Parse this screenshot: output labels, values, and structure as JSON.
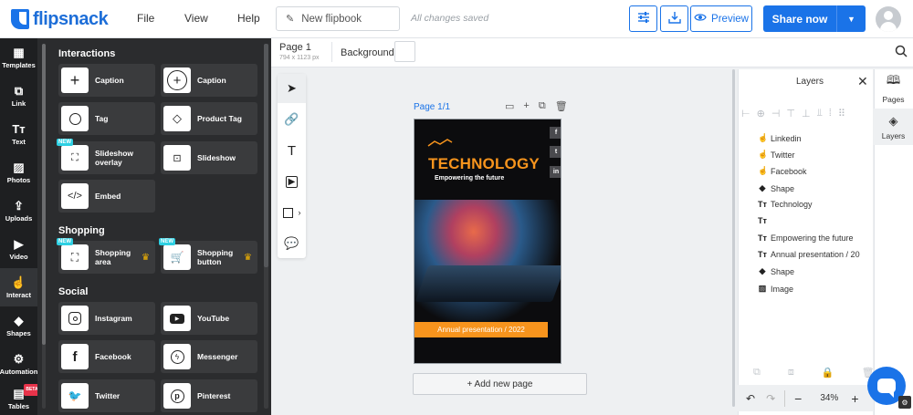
{
  "brand": {
    "name": "flipsnack"
  },
  "menu": {
    "file": "File",
    "view": "View",
    "help": "Help"
  },
  "title_field": {
    "value": "New flipbook"
  },
  "status": {
    "saved": "All changes saved"
  },
  "header_actions": {
    "preview": "Preview",
    "share": "Share now"
  },
  "rail": [
    {
      "label": "Templates",
      "icon": "templates-icon"
    },
    {
      "label": "Link",
      "icon": "link-icon"
    },
    {
      "label": "Text",
      "icon": "text-icon"
    },
    {
      "label": "Photos",
      "icon": "photos-icon"
    },
    {
      "label": "Uploads",
      "icon": "uploads-icon"
    },
    {
      "label": "Video",
      "icon": "video-icon"
    },
    {
      "label": "Interact",
      "icon": "interact-icon"
    },
    {
      "label": "Shapes",
      "icon": "shapes-icon"
    },
    {
      "label": "Automation",
      "icon": "automation-icon"
    },
    {
      "label": "Tables",
      "icon": "tables-icon",
      "badge": "BETA"
    }
  ],
  "panel": {
    "interactions_title": "Interactions",
    "interactions": [
      {
        "label": "Caption",
        "icon": "plus-icon"
      },
      {
        "label": "Caption",
        "icon": "plus-circle-icon"
      },
      {
        "label": "Tag",
        "icon": "circle-icon"
      },
      {
        "label": "Product Tag",
        "icon": "price-tag-icon"
      },
      {
        "label": "Slideshow overlay",
        "icon": "slideshow-overlay-icon",
        "badge": "NEW"
      },
      {
        "label": "Slideshow",
        "icon": "slideshow-icon"
      },
      {
        "label": "Embed",
        "icon": "code-icon"
      }
    ],
    "shopping_title": "Shopping",
    "shopping": [
      {
        "label": "Shopping area",
        "icon": "shopping-area-icon",
        "badge": "NEW"
      },
      {
        "label": "Shopping button",
        "icon": "cart-icon",
        "badge": "NEW"
      }
    ],
    "social_title": "Social",
    "social": [
      {
        "label": "Instagram",
        "icon": "instagram-icon"
      },
      {
        "label": "YouTube",
        "icon": "youtube-icon"
      },
      {
        "label": "Facebook",
        "icon": "facebook-icon"
      },
      {
        "label": "Messenger",
        "icon": "messenger-icon"
      },
      {
        "label": "Twitter",
        "icon": "twitter-icon"
      },
      {
        "label": "Pinterest",
        "icon": "pinterest-icon"
      }
    ]
  },
  "subbar": {
    "page_name": "Page 1",
    "page_size": "794 x 1123 px",
    "background": "Background"
  },
  "canvas": {
    "page_label": "Page 1/1",
    "heading": "TECHNOLOGY",
    "subheading": "Empowering the future",
    "footer": "Annual presentation / 2022",
    "add_page": "+ Add new page"
  },
  "layers": {
    "title": "Layers",
    "items": [
      {
        "name": "Linkedin",
        "icon": "interact-icon"
      },
      {
        "name": "Twitter",
        "icon": "interact-icon"
      },
      {
        "name": "Facebook",
        "icon": "interact-icon"
      },
      {
        "name": "Shape",
        "icon": "shapes-icon"
      },
      {
        "name": "Technology",
        "icon": "text-icon"
      },
      {
        "name": "",
        "icon": "text-icon"
      },
      {
        "name": "Empowering the future",
        "icon": "text-icon"
      },
      {
        "name": "Annual presentation / 20",
        "icon": "text-icon"
      },
      {
        "name": "Shape",
        "icon": "shapes-icon"
      },
      {
        "name": "Image",
        "icon": "image-icon"
      }
    ]
  },
  "zoom": {
    "value": "34%"
  },
  "right_rail": {
    "pages": "Pages",
    "layers": "Layers"
  },
  "colors": {
    "accent": "#1a73e8",
    "brand_orange": "#f7941d",
    "panel_bg": "#2b2c2e"
  }
}
